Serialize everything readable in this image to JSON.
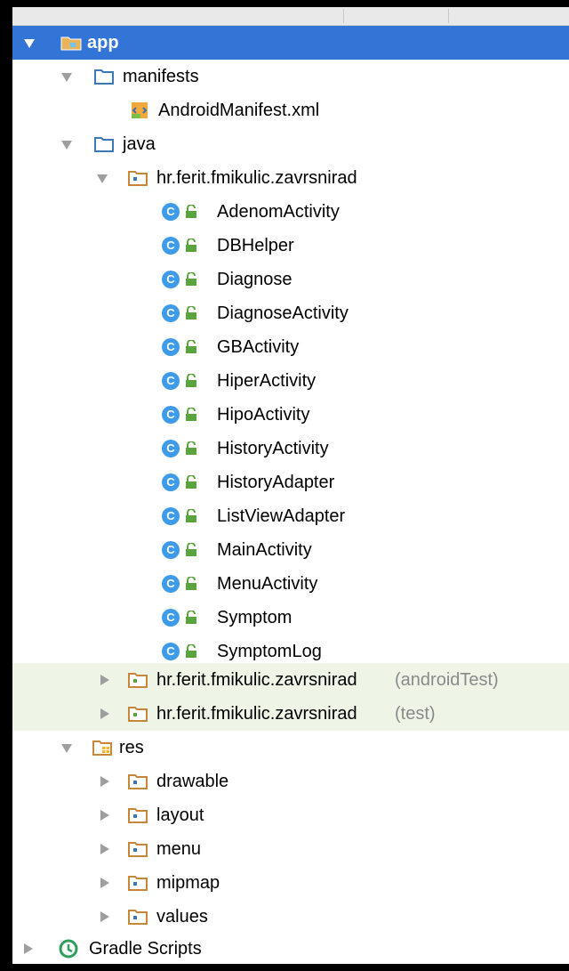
{
  "tree": {
    "app": {
      "label": "app",
      "icon": "app-module-folder-icon"
    },
    "manifests": {
      "label": "manifests",
      "icon": "folder-icon"
    },
    "manifest_file": {
      "label": "AndroidManifest.xml",
      "icon": "xml-manifest-icon"
    },
    "java": {
      "label": "java",
      "icon": "folder-icon"
    },
    "main_package": {
      "label": "hr.ferit.fmikulic.zavrsnirad",
      "icon": "package-icon"
    },
    "classes": [
      {
        "label": "AdenomActivity"
      },
      {
        "label": "DBHelper"
      },
      {
        "label": "Diagnose"
      },
      {
        "label": "DiagnoseActivity"
      },
      {
        "label": "GBActivity"
      },
      {
        "label": "HiperActivity"
      },
      {
        "label": "HipoActivity"
      },
      {
        "label": "HistoryActivity"
      },
      {
        "label": "HistoryAdapter"
      },
      {
        "label": "ListViewAdapter"
      },
      {
        "label": "MainActivity"
      },
      {
        "label": "MenuActivity"
      },
      {
        "label": "Symptom"
      },
      {
        "label": "SymptomLog"
      }
    ],
    "android_test_package": {
      "label": "hr.ferit.fmikulic.zavrsnirad",
      "suffix": "(androidTest)"
    },
    "test_package": {
      "label": "hr.ferit.fmikulic.zavrsnirad",
      "suffix": "(test)"
    },
    "res": {
      "label": "res",
      "icon": "resources-folder-icon"
    },
    "res_children": [
      {
        "label": "drawable"
      },
      {
        "label": "layout"
      },
      {
        "label": "menu"
      },
      {
        "label": "mipmap"
      },
      {
        "label": "values"
      }
    ],
    "gradle": {
      "label": "Gradle Scripts",
      "icon": "gradle-icon"
    }
  },
  "colors": {
    "selection": "#3375d6",
    "class_icon": "#3d9be9",
    "lock_icon": "#5aa33f",
    "folder": "#c8863a",
    "package": "#8aa0b4",
    "highlight_row": "#eef4e6"
  }
}
